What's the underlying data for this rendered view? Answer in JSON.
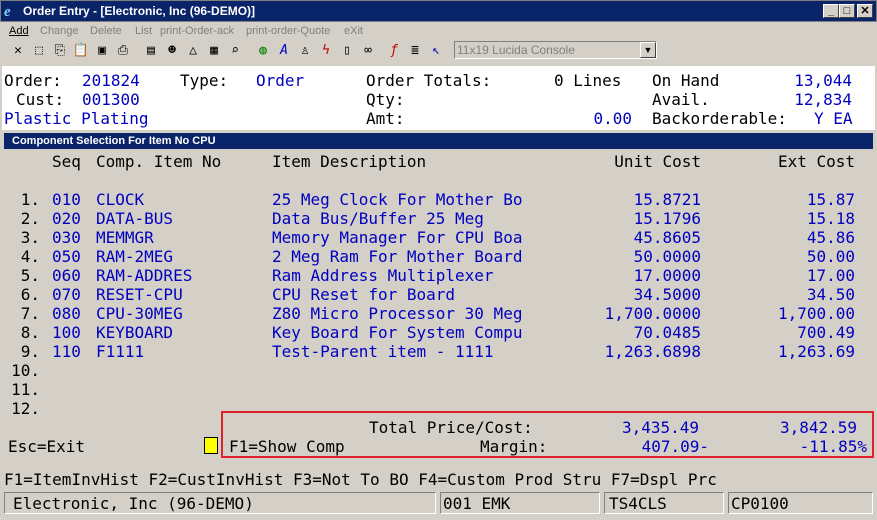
{
  "window": {
    "title": "Order Entry - [Electronic, Inc (96-DEMO)]",
    "app_icon": "app-logo-icon",
    "buttons": {
      "minimize": "_",
      "maximize": "□",
      "close": "✕"
    }
  },
  "menu": {
    "items": [
      {
        "label": "Add",
        "enabled": true
      },
      {
        "label": "Change",
        "enabled": false
      },
      {
        "label": "Delete",
        "enabled": false
      },
      {
        "label": "List",
        "enabled": false
      },
      {
        "label": "print-Order-ack",
        "enabled": false
      },
      {
        "label": "print-order-Quote",
        "enabled": false
      },
      {
        "label": "eXit",
        "enabled": false
      }
    ]
  },
  "toolbar": {
    "font_selector": "11x19 Lucida Console"
  },
  "header": {
    "order_label": "Order:",
    "order_value": "201824",
    "type_label": "Type:",
    "type_value": "Order",
    "totals_label": "Order Totals:",
    "lines_value": "0 Lines",
    "onhand_label": "On Hand",
    "onhand_value": "13,044",
    "cust_label": "Cust:",
    "cust_value": "001300",
    "qty_label": "Qty:",
    "avail_label": "Avail.",
    "avail_value": "12,834",
    "cust_name": "Plastic Plating",
    "amt_label": "Amt:",
    "amt_value": "0.00",
    "backorder_label": "Backorderable:",
    "backorder_value": "Y EA"
  },
  "section_title": "Component Selection For Item No CPU",
  "columns": {
    "seq": "Seq",
    "comp": "Comp. Item No",
    "desc": "Item Description",
    "unit": "Unit Cost",
    "ext": "Ext Cost"
  },
  "rows": [
    {
      "n": "1.",
      "seq": "010",
      "comp": "CLOCK",
      "desc": "25 Meg Clock For Mother Bo",
      "unit": "15.8721",
      "ext": "15.87"
    },
    {
      "n": "2.",
      "seq": "020",
      "comp": "DATA-BUS",
      "desc": "Data Bus/Buffer 25 Meg",
      "unit": "15.1796",
      "ext": "15.18"
    },
    {
      "n": "3.",
      "seq": "030",
      "comp": "MEMMGR",
      "desc": "Memory Manager For CPU Boa",
      "unit": "45.8605",
      "ext": "45.86"
    },
    {
      "n": "4.",
      "seq": "050",
      "comp": "RAM-2MEG",
      "desc": "2 Meg Ram For Mother Board",
      "unit": "50.0000",
      "ext": "50.00"
    },
    {
      "n": "5.",
      "seq": "060",
      "comp": "RAM-ADDRES",
      "desc": "Ram Address Multiplexer",
      "unit": "17.0000",
      "ext": "17.00"
    },
    {
      "n": "6.",
      "seq": "070",
      "comp": "RESET-CPU",
      "desc": "CPU Reset for Board",
      "unit": "34.5000",
      "ext": "34.50"
    },
    {
      "n": "7.",
      "seq": "080",
      "comp": "CPU-30MEG",
      "desc": "Z80 Micro Processor 30 Meg",
      "unit": "1,700.0000",
      "ext": "1,700.00"
    },
    {
      "n": "8.",
      "seq": "100",
      "comp": "KEYBOARD",
      "desc": "Key Board For System Compu",
      "unit": "70.0485",
      "ext": "700.49"
    },
    {
      "n": "9.",
      "seq": "110",
      "comp": "F1111",
      "desc": "Test-Parent item - 1111",
      "unit": "1,263.6898",
      "ext": "1,263.69"
    },
    {
      "n": "10.",
      "seq": "",
      "comp": "",
      "desc": "",
      "unit": "",
      "ext": ""
    },
    {
      "n": "11.",
      "seq": "",
      "comp": "",
      "desc": "",
      "unit": "",
      "ext": ""
    },
    {
      "n": "12.",
      "seq": "",
      "comp": "",
      "desc": "",
      "unit": "",
      "ext": ""
    }
  ],
  "totals": {
    "label": "Total Price/Cost:",
    "price": "3,435.49",
    "cost": "3,842.59",
    "margin_label": "Margin:",
    "margin_amt": "407.09-",
    "margin_pct": "-11.85%"
  },
  "footer": {
    "esc": "Esc=Exit",
    "f1": "F1=Show Comp"
  },
  "fkeys": "F1=ItemInvHist F2=CustInvHist F3=Not To BO F4=Custom Prod Stru F7=Dspl Prc",
  "status": {
    "company": "Electronic, Inc (96-DEMO)",
    "user": "001 EMK",
    "terminal": "TS4CLS",
    "program": "CP0100"
  }
}
